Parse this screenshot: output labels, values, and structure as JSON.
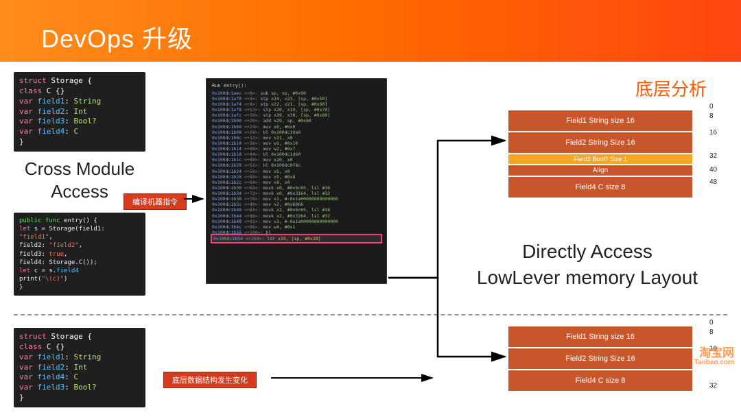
{
  "header": {
    "title": "DevOps 升级"
  },
  "labels": {
    "cma": "Cross Module\nAccess",
    "analysis": "底层分析",
    "direct": "Directly Access\nLowLever memory Layout"
  },
  "tags": {
    "compile": "编译机器指令",
    "layout_change": "底层数据结构发生变化"
  },
  "code1": {
    "l1a": "struct ",
    "l1b": "Storage {",
    "l2a": " class ",
    "l2b": "C {}",
    "l3a": " var ",
    "l3b": "field1",
    "l3c": ": ",
    "l3d": "String",
    "l4a": "  var ",
    "l4b": "field2",
    "l4c": ": ",
    "l4d": "Int",
    "l5a": "  var ",
    "l5b": "field3",
    "l5c": ": ",
    "l5d": "Bool?",
    "l6a": " var ",
    "l6b": "field4",
    "l6c": ": ",
    "l6d": "C",
    "l7": "}"
  },
  "code2": {
    "l1a": "public func ",
    "l1b": "entry() {",
    "l2a": " let ",
    "l2b": "s = Storage(field1: ",
    "l2c": "\"field1\"",
    "l2d": ",",
    "l3a": "          field2: ",
    "l3b": "\"field2\"",
    "l3c": ",",
    "l4a": "          field3: ",
    "l4b": "true",
    "l4c": ",",
    "l5a": "          field4: Storage.C());",
    "l6a": " let ",
    "l6b": "c = s.",
    "l6c": "field4",
    "l7a": " print(",
    "l7b": "\"\\(c)\"",
    "l7c": ")",
    "l8": "}"
  },
  "code3": {
    "l1a": "struct ",
    "l1b": "Storage {",
    "l2a": " class ",
    "l2b": "C {}",
    "l3a": " var ",
    "l3b": "field1",
    "l3c": ": ",
    "l3d": "String",
    "l4a": "  var ",
    "l4b": "field2",
    "l4c": ": ",
    "l4d": "Int",
    "l5a": " var ",
    "l5b": "field4",
    "l5c": ": ",
    "l5d": "C",
    "l6a": "  var ",
    "l6b": "field3",
    "l6c": ": ",
    "l6d": "Bool?",
    "l7": "}"
  },
  "asm": {
    "title": "Run`entry():",
    "lines": [
      {
        "addr": "0x100dc1aec",
        "off": "<+0>:",
        "op": "sub",
        "arg": "sp, sp, #0x90"
      },
      {
        "addr": "0x100dc1af0",
        "off": "<+4>:",
        "op": "stp",
        "arg": "x24, x23, [sp, #0x50]"
      },
      {
        "addr": "0x100dc1af4",
        "off": "<+8>:",
        "op": "stp",
        "arg": "x22, x21, [sp, #0x60]"
      },
      {
        "addr": "0x100dc1af8",
        "off": "<+12>:",
        "op": "stp",
        "arg": "x20, x19, [sp, #0x70]"
      },
      {
        "addr": "0x100dc1afc",
        "off": "<+16>:",
        "op": "stp",
        "arg": "x29, x30, [sp, #0x80]"
      },
      {
        "addr": "0x100dc1b00",
        "off": "<+20>:",
        "op": "add",
        "arg": "x29, sp, #0x80"
      },
      {
        "addr": "0x100dc1b04",
        "off": "<+24>:",
        "op": "mov",
        "arg": "x0, #0x0"
      },
      {
        "addr": "0x100dc1b08",
        "off": "<+28>:",
        "op": "bl",
        "arg": "0x100dc19a0"
      },
      {
        "addr": "0x100dc1b0c",
        "off": "<+32>:",
        "op": "mov",
        "arg": "x21, x0"
      },
      {
        "addr": "0x100dc1b10",
        "off": "<+36>:",
        "op": "mov",
        "arg": "w1, #0x10"
      },
      {
        "addr": "0x100dc1b14",
        "off": "<+40>:",
        "op": "mov",
        "arg": "w2, #0x7"
      },
      {
        "addr": "0x100dc1b18",
        "off": "<+44>:",
        "op": "bl",
        "arg": "0x100dc1d60"
      },
      {
        "addr": "0x100dc1b1c",
        "off": "<+48>:",
        "op": "mov",
        "arg": "x20, x0"
      },
      {
        "addr": "0x100dc1b20",
        "off": "<+52>:",
        "op": "bl",
        "arg": "0x100dc0f8c"
      },
      {
        "addr": "0x100dc1b24",
        "off": "<+56>:",
        "op": "mov",
        "arg": "x5, x0"
      },
      {
        "addr": "0x100dc1b28",
        "off": "<+60>:",
        "op": "mov",
        "arg": "x5, #0x8"
      },
      {
        "addr": "0x100dc1b2c",
        "off": "<+64>:",
        "op": "mov",
        "arg": "x8, x0"
      },
      {
        "addr": "0x100dc1b30",
        "off": "<+68>:",
        "op": "movk",
        "arg": "x0, #0x6c65, lsl #16"
      },
      {
        "addr": "0x100dc1b34",
        "off": "<+72>:",
        "op": "movk",
        "arg": "x0, #0x3164, lsl #32"
      },
      {
        "addr": "0x100dc1b38",
        "off": "<+76>:",
        "op": "mov",
        "arg": "x1, #-0x1a00000000000000"
      },
      {
        "addr": "0x100dc1b3c",
        "off": "<+80>:",
        "op": "mov",
        "arg": "x2, #0x6966"
      },
      {
        "addr": "0x100dc1b40",
        "off": "<+84>:",
        "op": "movk",
        "arg": "x2, #0x6c65, lsl #16"
      },
      {
        "addr": "0x100dc1b44",
        "off": "<+88>:",
        "op": "movk",
        "arg": "x2, #0x3264, lsl #32"
      },
      {
        "addr": "0x100dc1b48",
        "off": "<+92>:",
        "op": "mov",
        "arg": "x3, #-0x1a00000000000000"
      },
      {
        "addr": "0x100dc1b4c",
        "off": "<+96>:",
        "op": "mov",
        "arg": "w4, #0x1"
      },
      {
        "addr": "0x100dc1b50",
        "off": "<+100>:",
        "op": "bl",
        "arg": ""
      }
    ],
    "hl": {
      "addr": "0x100dc1b54",
      "off": "<+104>:",
      "op": "ldr",
      "arg": "x19, [sp, #0x28]"
    }
  },
  "mem1": {
    "rows": [
      {
        "text": "Field1 String size 16",
        "cls": "big"
      },
      {
        "text": "Field2 String Size 16",
        "cls": "big"
      },
      {
        "text": "Field3 Bool? Size 1",
        "cls": "small"
      },
      {
        "text": "Align",
        "cls": "align"
      },
      {
        "text": "Field4 C size 8",
        "cls": "big"
      }
    ],
    "offsets": [
      "0",
      "8",
      "16",
      "",
      "32",
      "",
      "40",
      "48"
    ]
  },
  "mem2": {
    "rows": [
      {
        "text": "Field1 String size 16",
        "cls": "big"
      },
      {
        "text": "Field2 String Size 16",
        "cls": "big"
      },
      {
        "text": "Field4 C size 8",
        "cls": "big"
      }
    ],
    "offsets": [
      "0",
      "8",
      "16",
      "",
      "32"
    ]
  },
  "watermark": {
    "cn": "淘宝网",
    "en": "Taobao.com"
  }
}
